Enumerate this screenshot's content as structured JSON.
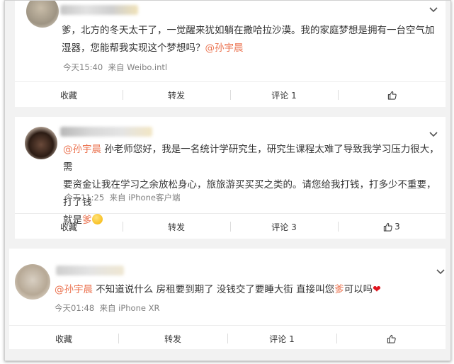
{
  "posts": [
    {
      "content_pre": "爹，北方的冬天太干了，一觉醒来犹如躺在撒哈拉沙漠。我的家庭梦想是拥有一台空气加湿器，您能帮我实现这个梦想吗？",
      "mention": "@孙宇晨",
      "time": "今天15:40",
      "source": "来自 Weibo.intl",
      "actions": {
        "collect": "收藏",
        "forward": "转发",
        "comment": "评论 1",
        "like": ""
      }
    },
    {
      "mention": "@孙宇晨",
      "content_line1": " 孙老师您好，我是一名统计学研究生，研究生课程太难了导致我学习压力很大，需",
      "content_line2": "要资金让我在学习之余放松身心，旅旅游买买买之类的。请您给我打钱，打多少不重要，打了钱",
      "content_line3_pre": "就是",
      "content_line3_hl": "爹",
      "emoji": "flushed-face-emoji",
      "time": "今天11:25",
      "source": "来自 iPhone客户端",
      "actions": {
        "collect": "收藏",
        "forward": "转发",
        "comment": "评论 3",
        "like": "3"
      }
    },
    {
      "mention": "@孙宇晨",
      "content_mid": " 不知道说什么 房租要到期了 没钱交了要睡大街 直接叫您",
      "content_hl": "爹",
      "content_post": "可以吗",
      "emoji": "red-heart-emoji",
      "time": "今天01:48",
      "source": "来自 iPhone XR",
      "actions": {
        "collect": "收藏",
        "forward": "转发",
        "comment": "评论 1",
        "like": ""
      }
    }
  ],
  "colors": {
    "accent": "#eb7350",
    "meta": "#808080",
    "heart": "#e0141e"
  }
}
